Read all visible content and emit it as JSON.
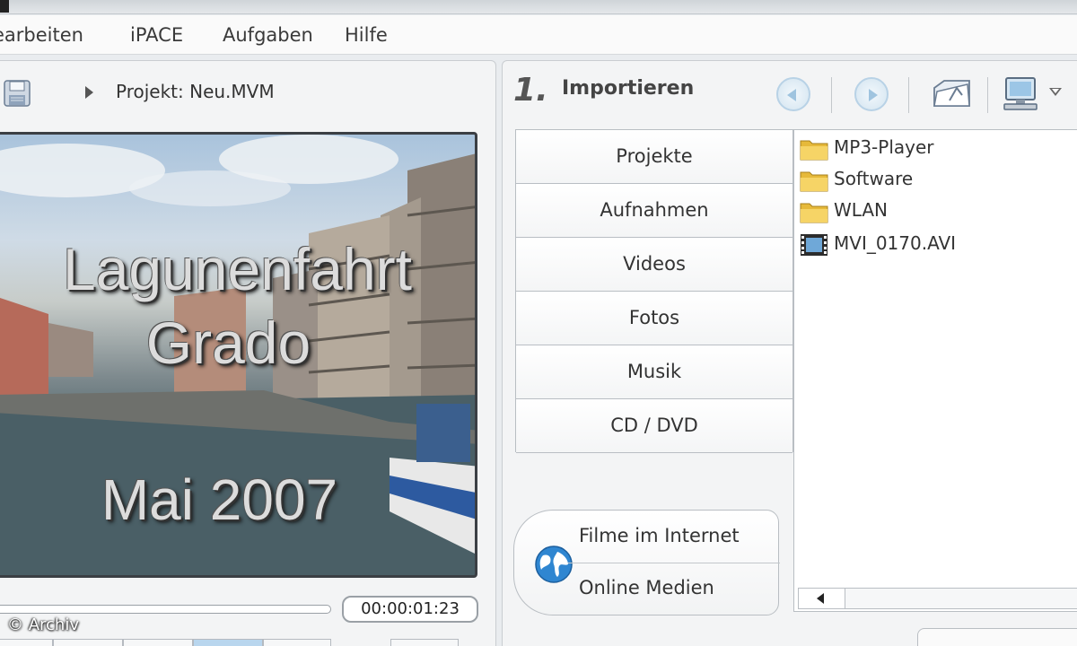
{
  "menu": {
    "items": [
      {
        "label": "earbeiten"
      },
      {
        "label": "iPACE"
      },
      {
        "label": "Aufgaben"
      },
      {
        "label": "Hilfe"
      }
    ]
  },
  "project": {
    "label": "Projekt: Neu.MVM"
  },
  "preview": {
    "overlay_line1": "Lagunenfahrt",
    "overlay_line2": "Grado",
    "overlay_line3": "Mai 2007"
  },
  "playback": {
    "timecode": "00:00:01:23"
  },
  "copyright": "© Archiv",
  "import_panel": {
    "step_number": "1.",
    "step_title": "Importieren",
    "categories": [
      {
        "label": "Projekte"
      },
      {
        "label": "Aufnahmen"
      },
      {
        "label": "Videos"
      },
      {
        "label": "Fotos"
      },
      {
        "label": "Musik"
      },
      {
        "label": "CD / DVD"
      }
    ],
    "files": [
      {
        "name": "MP3-Player",
        "icon": "folder-icon"
      },
      {
        "name": "Software",
        "icon": "folder-icon"
      },
      {
        "name": "WLAN",
        "icon": "folder-icon"
      },
      {
        "name": "MVI_0170.AVI",
        "icon": "video-file-icon"
      }
    ],
    "online": {
      "line1": "Filme im Internet",
      "line2": "Online Medien"
    }
  },
  "colors": {
    "panel_bg": "#f3f4f5",
    "border": "#c9cdd1",
    "preview_frame": "#3b3f44",
    "folder_yellow": "#f2c94c",
    "nav_blue": "#9fc4df"
  }
}
